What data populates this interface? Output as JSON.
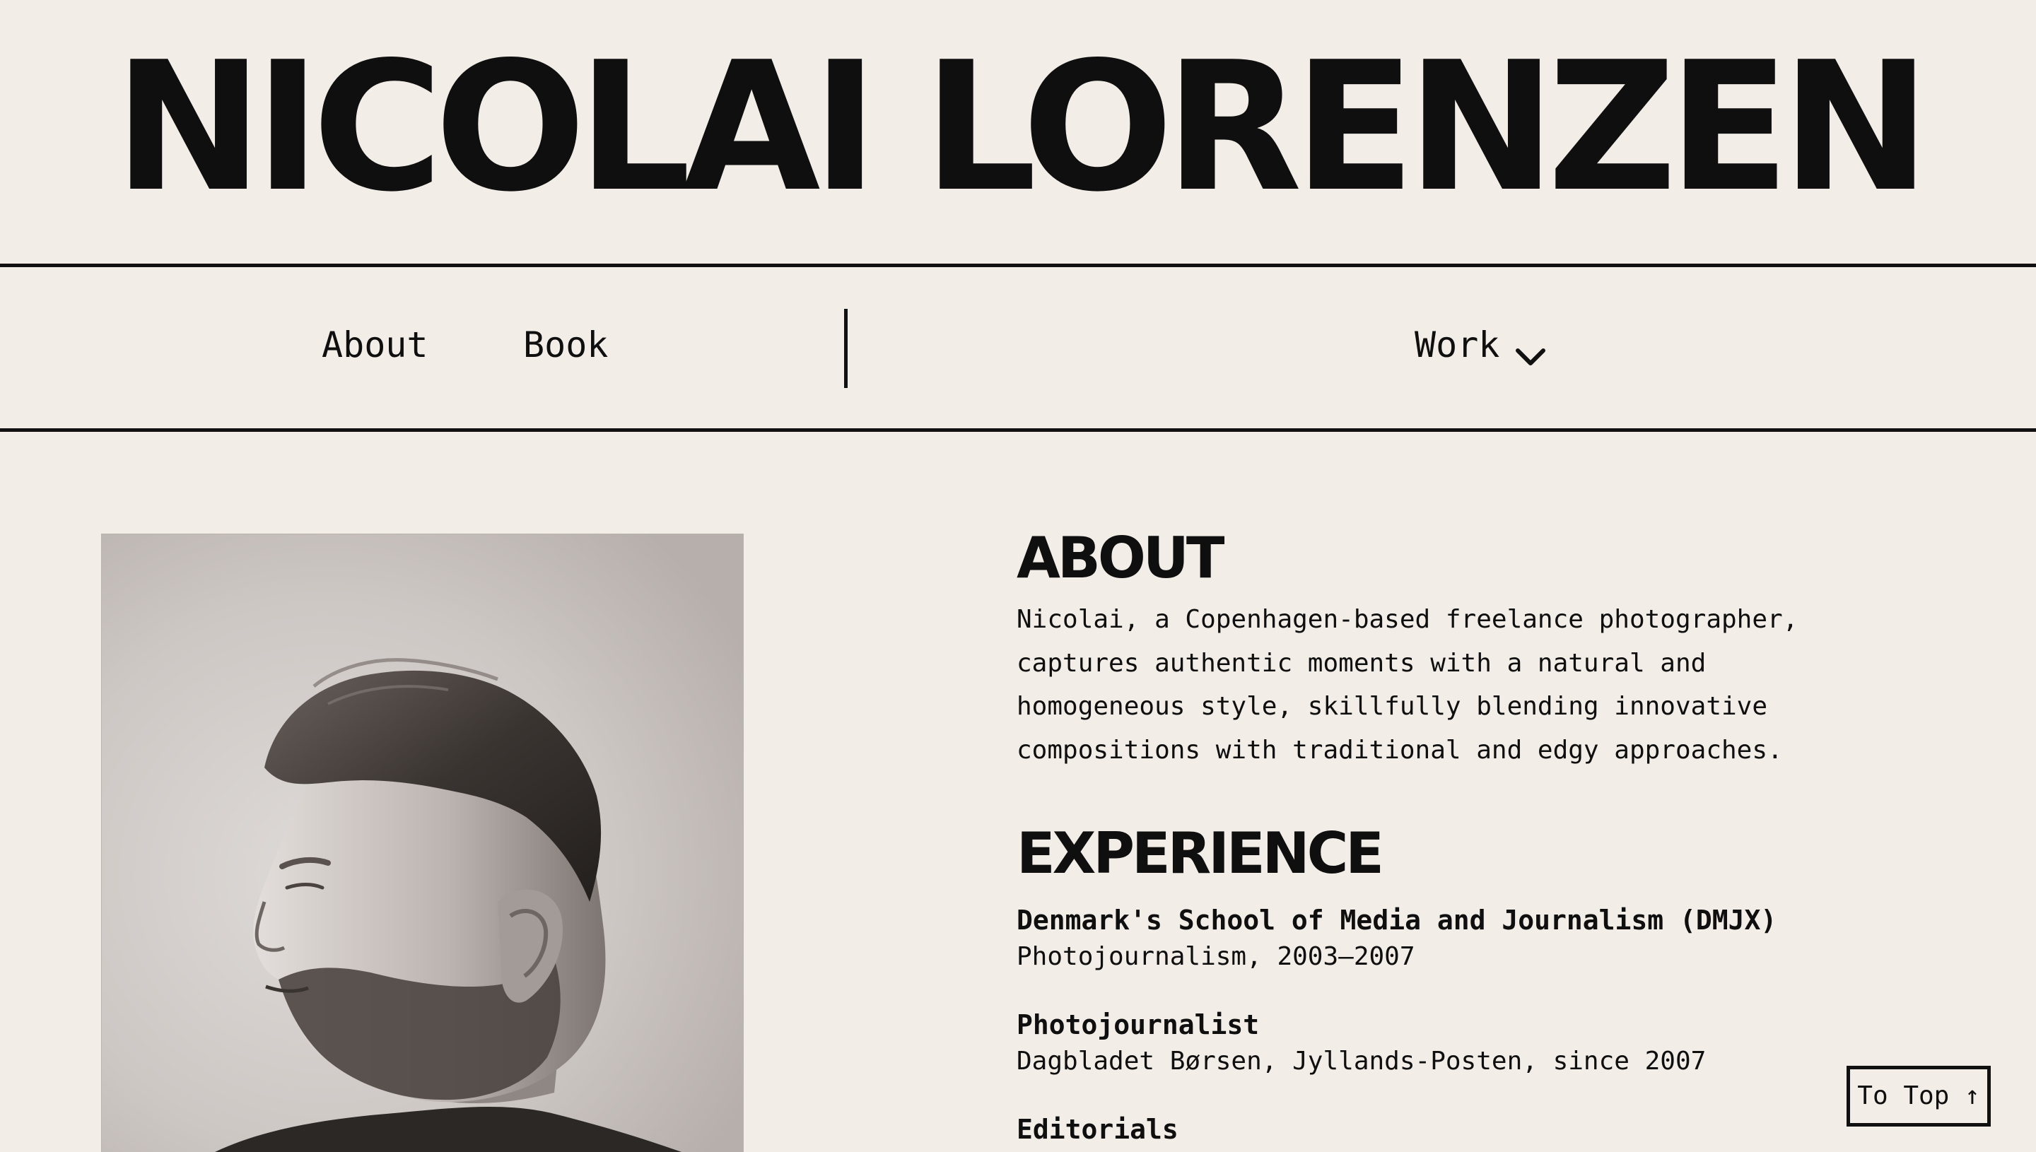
{
  "header": {
    "site_title": "NICOLAI LORENZEN"
  },
  "nav": {
    "about": "About",
    "book": "Book",
    "work": "Work"
  },
  "portrait": {
    "alt": "Black and white portrait of Nicolai Lorenzen in profile"
  },
  "about": {
    "heading": "ABOUT",
    "text": "Nicolai, a Copenhagen-based freelance photographer,\ncaptures authentic moments with a natural and\nhomogeneous style, skillfully blending innovative\ncompositions with traditional and edgy approaches."
  },
  "experience": {
    "heading": "EXPERIENCE",
    "items": [
      {
        "name": "Denmark's School of Media and Journalism (DMJX)",
        "detail": "Photojournalism, 2003–2007"
      },
      {
        "name": "Photojournalist",
        "detail": "Dagbladet Børsen, Jyllands-Posten, since 2007"
      },
      {
        "name": "Editorials",
        "detail": ""
      }
    ]
  },
  "to_top": {
    "label": "To Top ↑"
  },
  "colors": {
    "background": "#f2ede7",
    "ink": "#0f0f0f"
  }
}
